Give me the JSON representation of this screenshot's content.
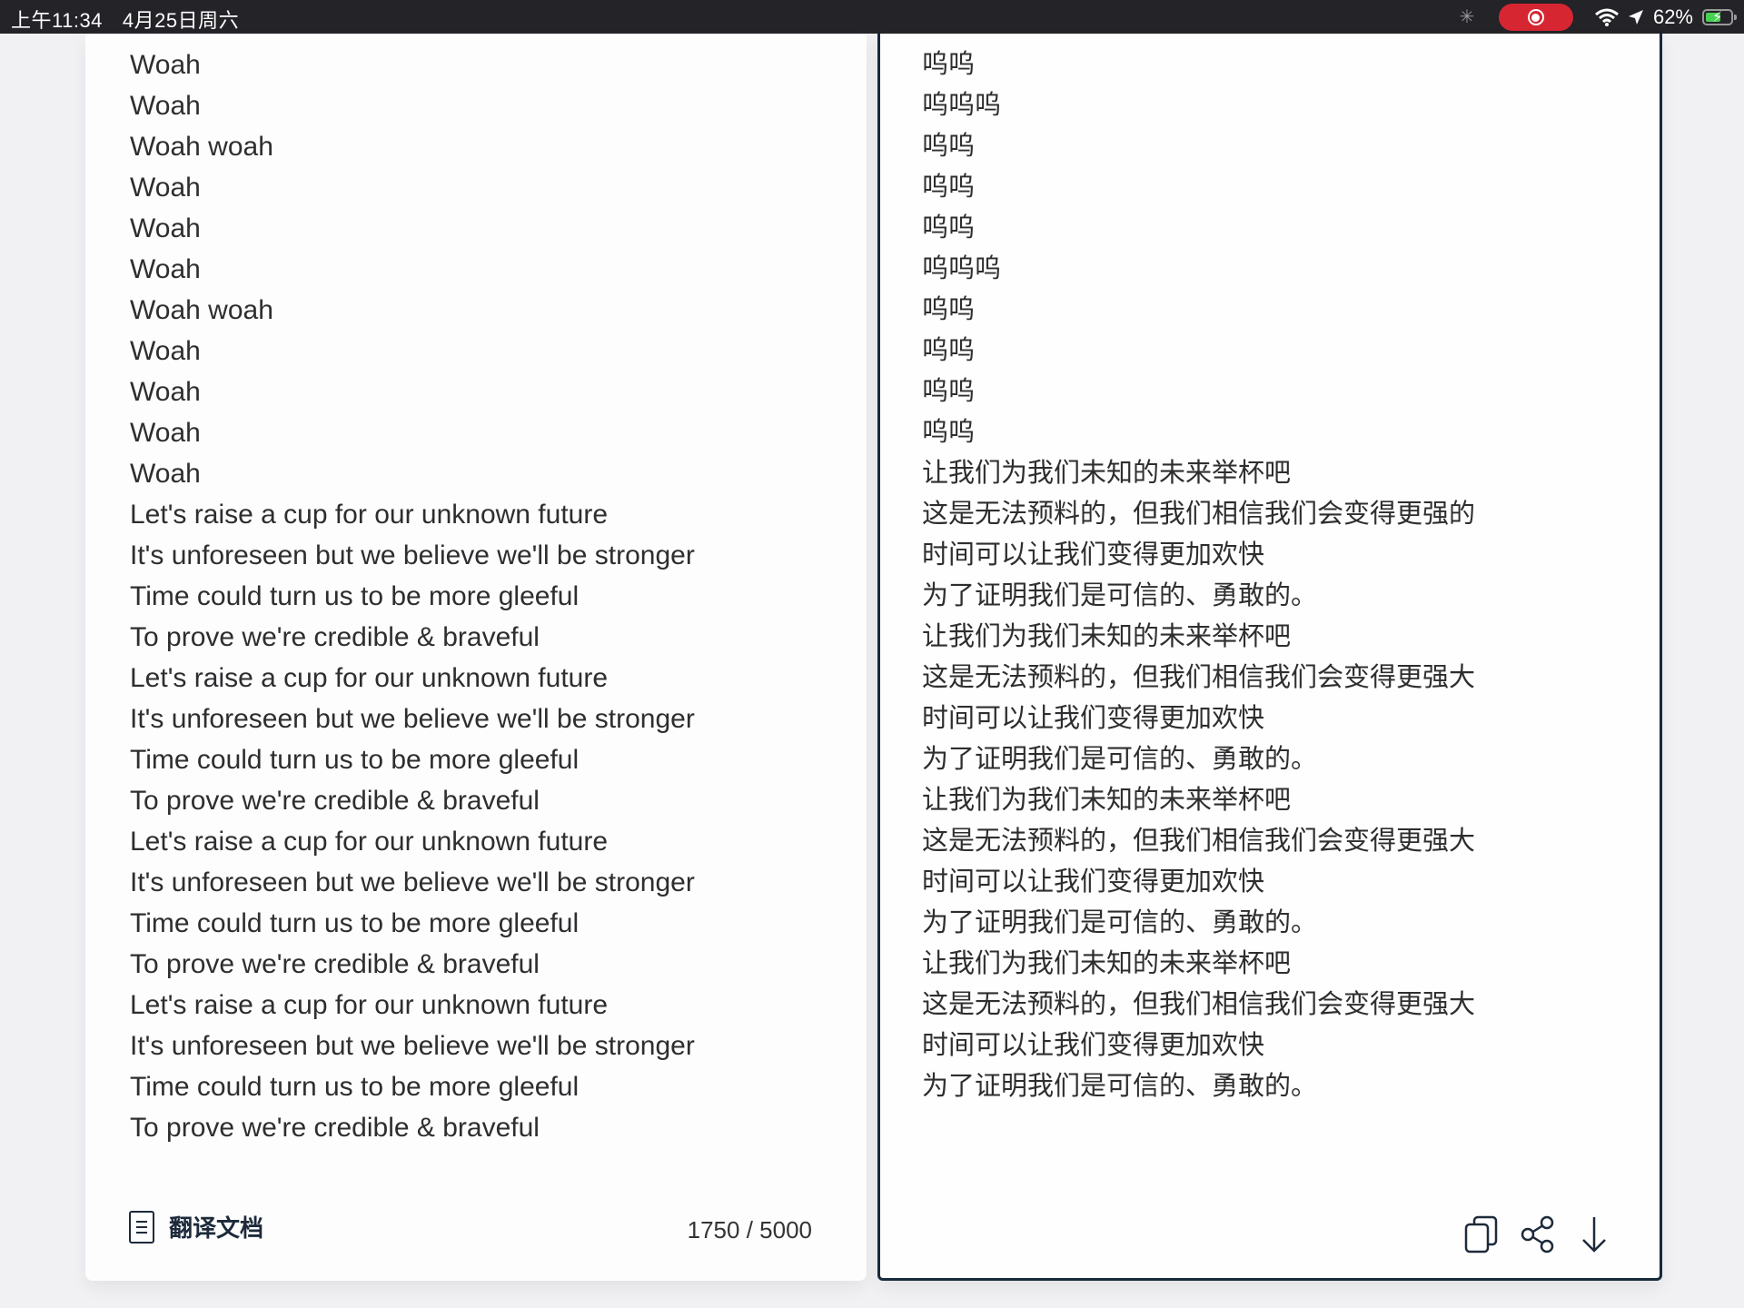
{
  "status_bar": {
    "time": "上午11:34",
    "date": "4月25日周六",
    "battery_percent": "62%",
    "battery_level": 0.62,
    "icons": [
      "activity-spinner-icon",
      "screen-recording-icon",
      "wifi-icon",
      "location-arrow-icon",
      "battery-charging-icon"
    ],
    "recording_color": "#d62632",
    "battery_color": "#46d151"
  },
  "source": {
    "lines": [
      "Woah",
      "Woah",
      "Woah woah",
      "Woah",
      "Woah",
      "Woah",
      "Woah woah",
      "Woah",
      "Woah",
      "Woah",
      "Woah",
      "Let's raise a cup for our unknown future",
      "It's unforeseen but we believe we'll be stronger",
      "Time could turn us to be more gleeful",
      "To prove we're credible & braveful",
      "Let's raise a cup for our unknown future",
      "It's unforeseen but we believe we'll be stronger",
      "Time could turn us to be more gleeful",
      "To prove we're credible & braveful",
      "Let's raise a cup for our unknown future",
      "It's unforeseen but we believe we'll be stronger",
      "Time could turn us to be more gleeful",
      "To prove we're credible & braveful",
      "Let's raise a cup for our unknown future",
      "It's unforeseen but we believe we'll be stronger",
      "Time could turn us to be more gleeful",
      "To prove we're credible & braveful"
    ],
    "translate_document_label": "翻译文档",
    "char_count": "1750 / 5000"
  },
  "target": {
    "lines": [
      "呜呜",
      "呜呜呜",
      "呜呜",
      "呜呜",
      "呜呜",
      "呜呜呜",
      "呜呜",
      "呜呜",
      "呜呜",
      "呜呜",
      "让我们为我们未知的未来举杯吧",
      "这是无法预料的，但我们相信我们会变得更强的",
      "时间可以让我们变得更加欢快",
      "为了证明我们是可信的、勇敢的。",
      "让我们为我们未知的未来举杯吧",
      "这是无法预料的，但我们相信我们会变得更强大",
      "时间可以让我们变得更加欢快",
      "为了证明我们是可信的、勇敢的。",
      "让我们为我们未知的未来举杯吧",
      "这是无法预料的，但我们相信我们会变得更强大",
      "时间可以让我们变得更加欢快",
      "为了证明我们是可信的、勇敢的。",
      "让我们为我们未知的未来举杯吧",
      "这是无法预料的，但我们相信我们会变得更强大",
      "时间可以让我们变得更加欢快",
      "为了证明我们是可信的、勇敢的。"
    ],
    "actions": [
      {
        "name": "copy-button",
        "icon": "copy-icon"
      },
      {
        "name": "share-button",
        "icon": "share-icon"
      },
      {
        "name": "download-button",
        "icon": "download-arrow-icon"
      }
    ]
  }
}
